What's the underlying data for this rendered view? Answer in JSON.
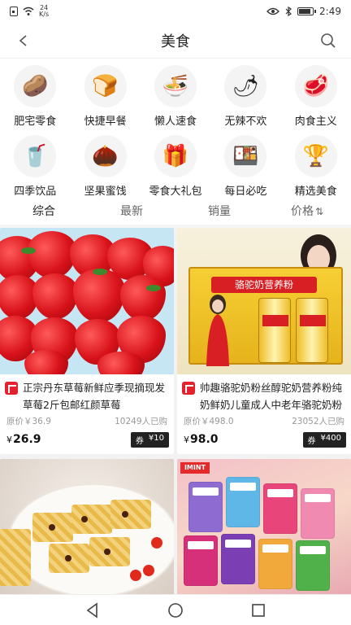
{
  "status_bar": {
    "network_speed_top": "24",
    "network_speed_unit": "K/s",
    "time": "2:49",
    "battery_level": 0.8
  },
  "header": {
    "title": "美食"
  },
  "categories": [
    {
      "label": "肥宅零食",
      "icon": "chips-icon",
      "glyph": "🥔"
    },
    {
      "label": "快捷早餐",
      "icon": "bread-icon",
      "glyph": "🍞"
    },
    {
      "label": "懒人速食",
      "icon": "noodles-icon",
      "glyph": "🍜"
    },
    {
      "label": "无辣不欢",
      "icon": "spicy-food-icon",
      "glyph": "🌶"
    },
    {
      "label": "肉食主义",
      "icon": "meat-icon",
      "glyph": "🥩"
    },
    {
      "label": "四季饮品",
      "icon": "drink-icon",
      "glyph": "🥤"
    },
    {
      "label": "坚果蜜饯",
      "icon": "nuts-icon",
      "glyph": "🌰"
    },
    {
      "label": "零食大礼包",
      "icon": "gift-pack-icon",
      "glyph": "🎁"
    },
    {
      "label": "每日必吃",
      "icon": "daily-food-icon",
      "glyph": "🍱"
    },
    {
      "label": "精选美食",
      "icon": "trophy-icon",
      "glyph": "🏆"
    }
  ],
  "sort_tabs": [
    {
      "label": "综合",
      "active": true
    },
    {
      "label": "最新",
      "active": false
    },
    {
      "label": "销量",
      "active": false
    },
    {
      "label": "价格",
      "active": false,
      "sort_icon": "⇅"
    }
  ],
  "products": [
    {
      "title": "正宗丹东草莓新鲜应季现摘现发草莓2斤包邮红颜草莓",
      "original_price": "原价￥36.9",
      "sold": "10249人已购",
      "currency": "¥",
      "price": "26.9",
      "coupon_label": "券",
      "coupon_value": "¥10"
    },
    {
      "title": "帅趣骆驼奶粉丝醇驼奶营养粉纯奶鲜奶儿童成人中老年骆驼奶粉",
      "original_price": "原价￥498.0",
      "sold": "23052人已购",
      "currency": "¥",
      "price": "98.0",
      "coupon_label": "券",
      "coupon_value": "¥400",
      "image_text": {
        "banner": "骆驼奶营养粉",
        "can_label": "骆驼奶营养粉"
      }
    },
    {
      "title": "",
      "image": "rice-cake-bars"
    },
    {
      "title": "",
      "image": "candy-packs",
      "image_text": {
        "brand": "IMINT"
      }
    }
  ],
  "colors": {
    "brand_red": "#e4222e",
    "coupon_bg": "#222222",
    "text_primary": "#222222",
    "text_secondary": "#999999"
  }
}
